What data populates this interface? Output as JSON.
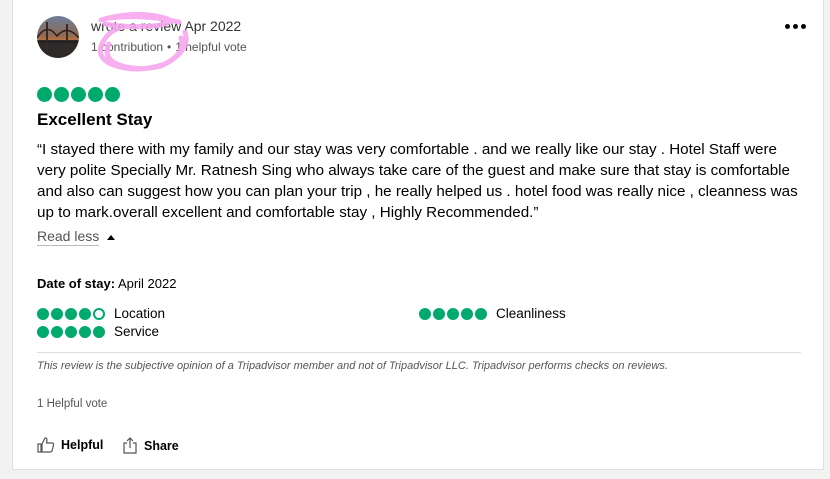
{
  "review": {
    "header": {
      "written_text": "wrote a review Apr 2022",
      "contributions": "1 contribution",
      "separator": "•",
      "helpful_votes_meta": "1 helpful vote"
    },
    "rating": 5,
    "title": "Excellent Stay",
    "body": "“I stayed there with my family and our stay was very comfortable . and we really like our stay . Hotel Staff were very polite Specially Mr. Ratnesh Sing who always take care of the guest and make sure that stay is comfortable and also can suggest how you can plan your trip , he really helped us . hotel food was really nice , cleanness was up to mark.overall excellent and comfortable stay , Highly Recommended.”",
    "read_less": "Read less",
    "date_of_stay_label": "Date of stay:",
    "date_of_stay_value": "April 2022",
    "sub_ratings": [
      {
        "label": "Location",
        "value": 4
      },
      {
        "label": "Cleanliness",
        "value": 5
      },
      {
        "label": "Service",
        "value": 5
      }
    ],
    "disclaimer": "This review is the subjective opinion of a Tripadvisor member and not of Tripadvisor LLC. Tripadvisor performs checks on reviews.",
    "helpful_count": "1 Helpful vote",
    "actions": {
      "helpful": "Helpful",
      "share": "Share"
    }
  },
  "colors": {
    "bubble_green": "#00aa6c",
    "scribble_pink": "#f7a6ee"
  },
  "icons": [
    "avatar-photo",
    "more-options-icon",
    "thumbs-up-icon",
    "share-icon",
    "caret-up-icon"
  ]
}
